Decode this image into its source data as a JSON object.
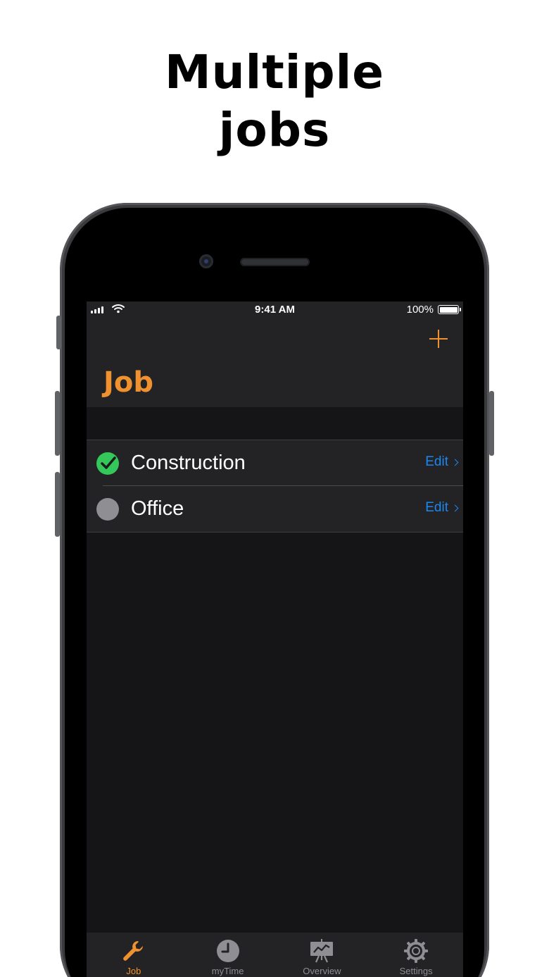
{
  "promo": {
    "headline_line1": "Multiple",
    "headline_line2": "jobs"
  },
  "status_bar": {
    "time": "9:41 AM",
    "battery": "100%"
  },
  "nav": {
    "title": "Job",
    "add_icon": "plus-icon"
  },
  "jobs": [
    {
      "name": "Construction",
      "active": true,
      "edit_label": "Edit"
    },
    {
      "name": "Office",
      "active": false,
      "edit_label": "Edit"
    }
  ],
  "tabs": [
    {
      "label": "Job",
      "icon": "wrench-icon",
      "selected": true
    },
    {
      "label": "myTime",
      "icon": "clock-icon",
      "selected": false
    },
    {
      "label": "Overview",
      "icon": "chart-board-icon",
      "selected": false
    },
    {
      "label": "Settings",
      "icon": "gear-icon",
      "selected": false
    }
  ],
  "colors": {
    "accent": "#f0912f",
    "link": "#1d87f0",
    "active": "#34c759",
    "inactive": "#8e8e93",
    "screen_bg": "#151517",
    "bar_bg": "#232325"
  }
}
